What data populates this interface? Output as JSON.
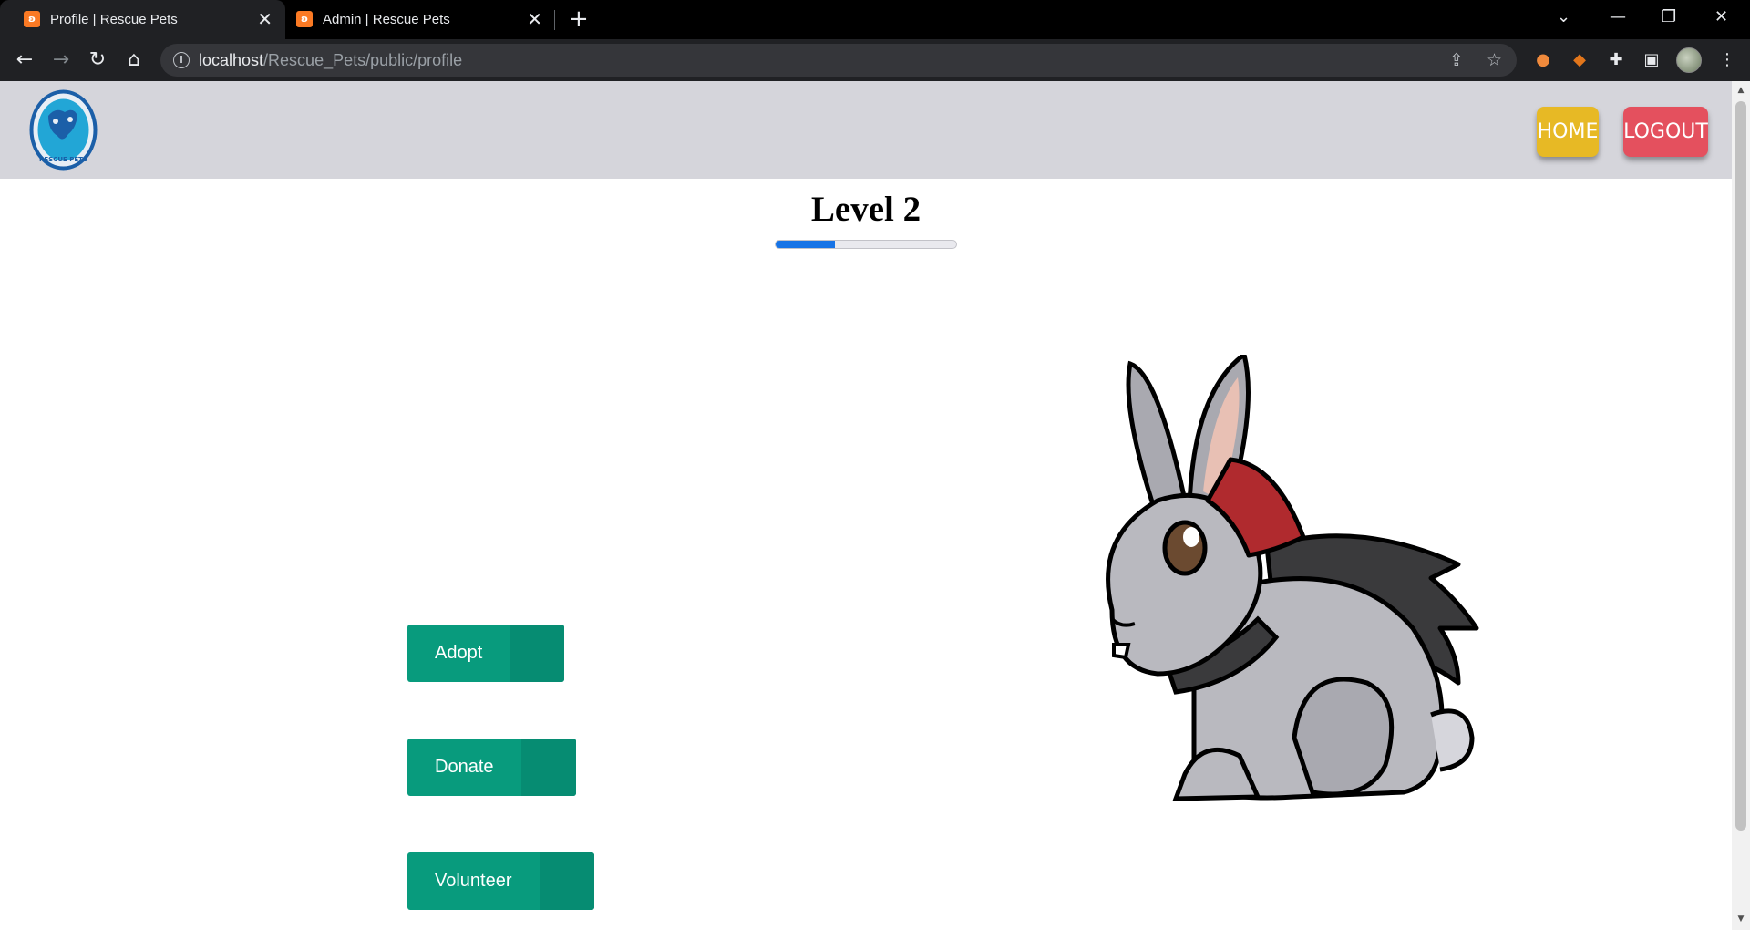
{
  "browser": {
    "tabs": [
      {
        "title": "Profile | Rescue Pets",
        "active": true
      },
      {
        "title": "Admin | Rescue Pets",
        "active": false
      }
    ],
    "url_host": "localhost",
    "url_path": "/Rescue_Pets/public/profile"
  },
  "header": {
    "logo_text": "RESCUE PETS",
    "home_label": "HOME",
    "logout_label": "LOGOUT",
    "home_color": "#e7b925",
    "logout_color": "#e4505e"
  },
  "profile": {
    "level_title": "Level 2",
    "progress_fraction": 0.33,
    "progress_color": "#1673e6"
  },
  "actions": [
    {
      "label": "Adopt"
    },
    {
      "label": "Donate"
    },
    {
      "label": "Volunteer"
    }
  ],
  "theme": {
    "header_bg": "#d5d5db",
    "action_bg": "#089b7d"
  }
}
